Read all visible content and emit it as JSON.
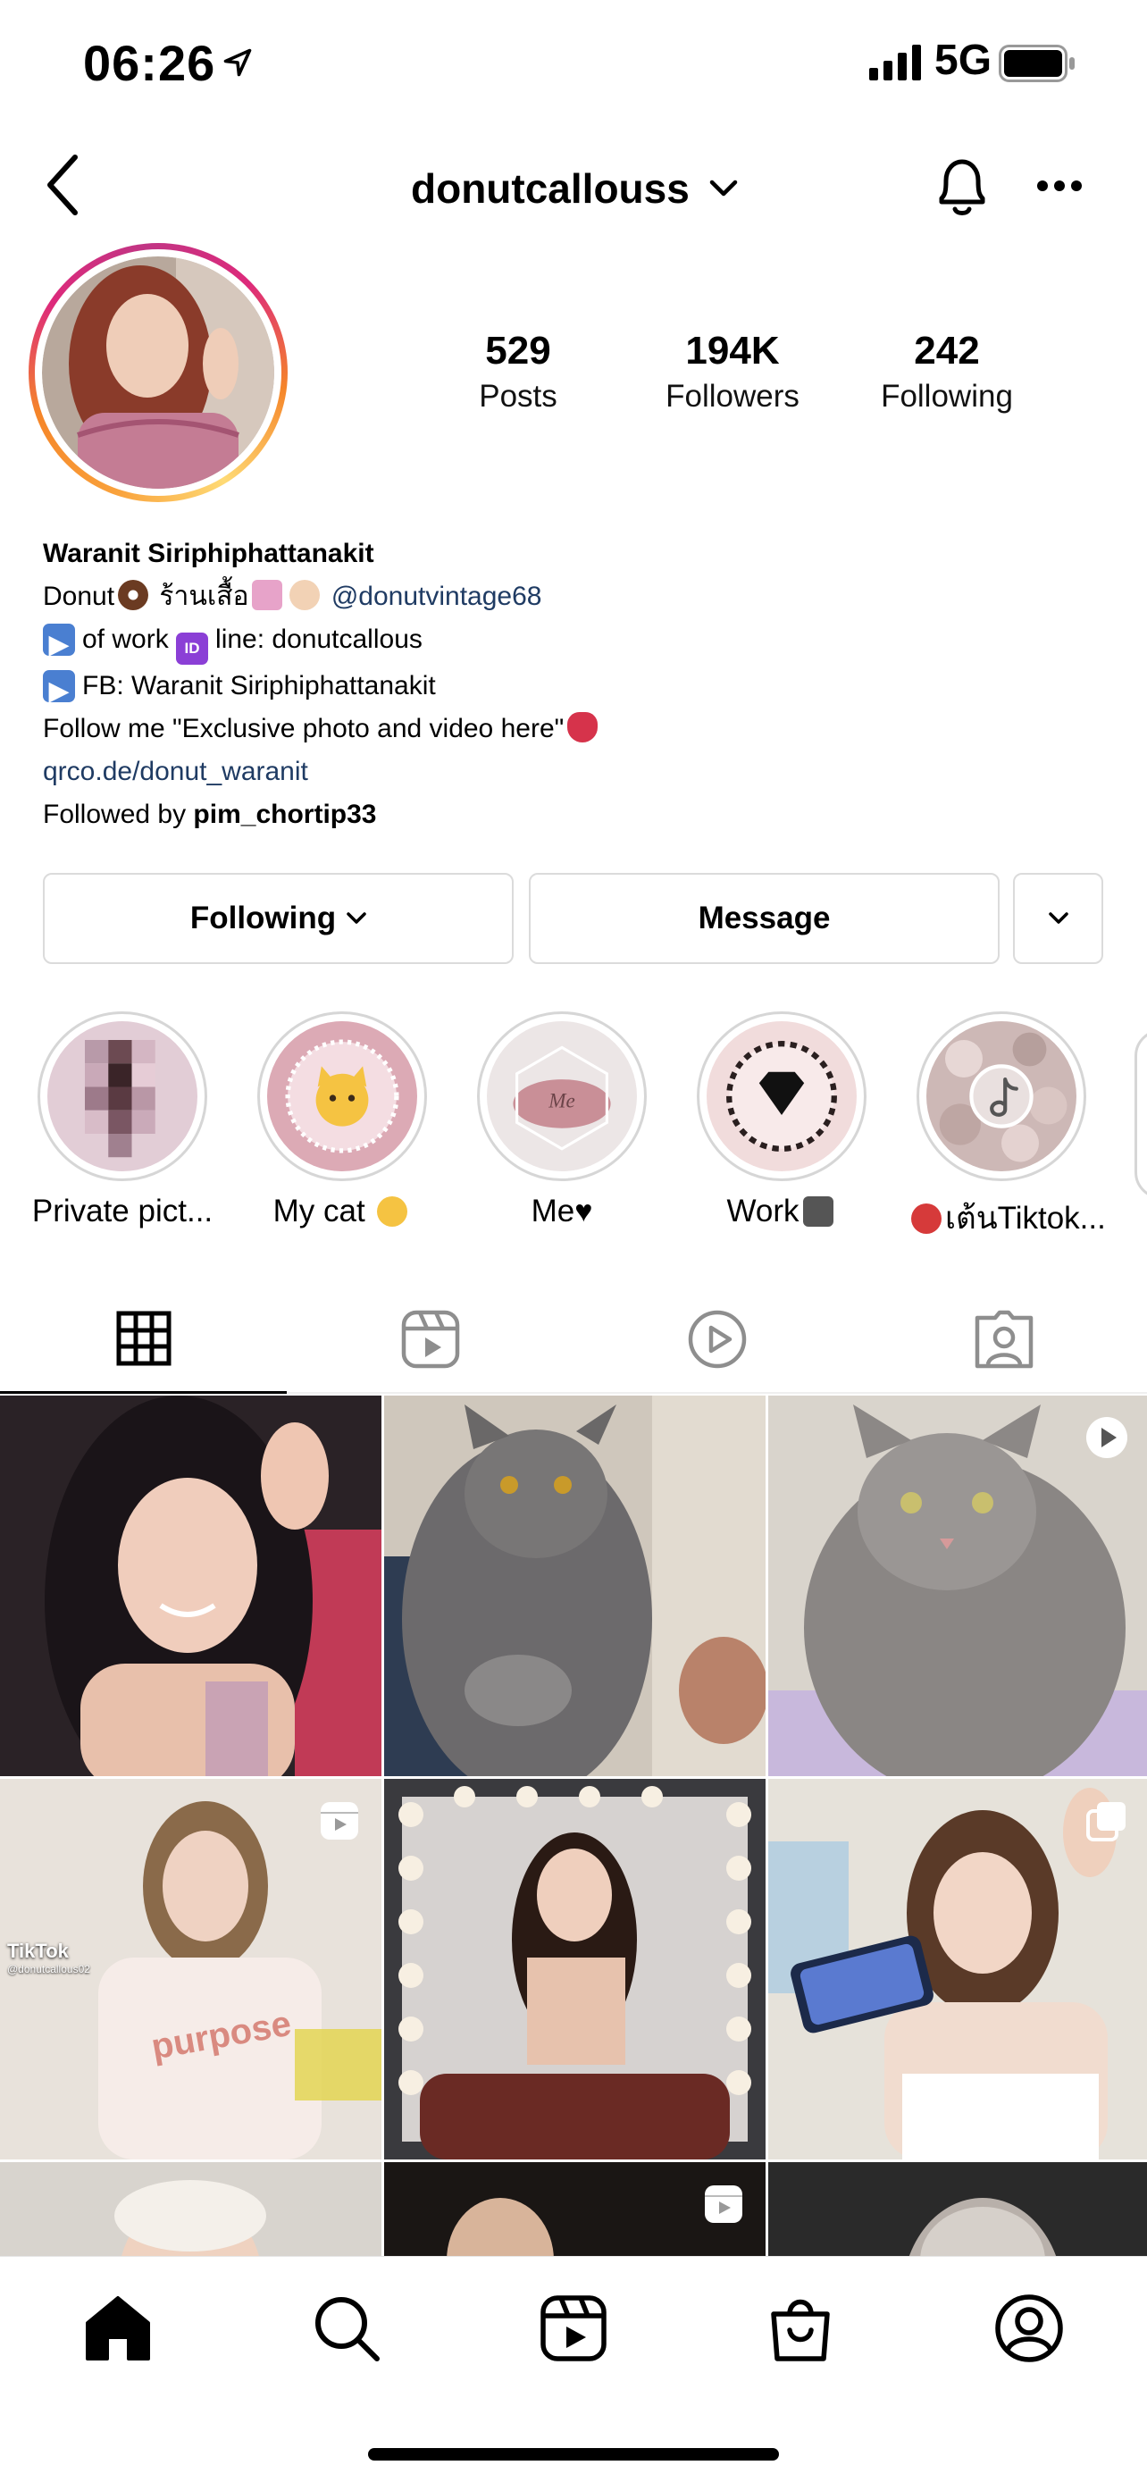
{
  "status_bar": {
    "time": "06:26",
    "network": "5G"
  },
  "header": {
    "username": "donutcallouss"
  },
  "profile": {
    "stats": [
      {
        "value": "529",
        "label": "Posts"
      },
      {
        "value": "194K",
        "label": "Followers"
      },
      {
        "value": "242",
        "label": "Following"
      }
    ],
    "name": "Waranit Siriphiphattanakit",
    "bio_line1_text": "Donut",
    "bio_line1_thai": "ร้านเสื้อ",
    "bio_line1_mention": "@donutvintage68",
    "bio_line2_a": "of work",
    "bio_line2_b": "line: donutcallous",
    "bio_line3": "FB: Waranit Siriphiphattanakit",
    "bio_line4": "Follow me \"Exclusive photo and video here\"",
    "bio_link": "qrco.de/donut_waranit",
    "followed_by_prefix": "Followed by",
    "followed_by_user": "pim_chortip33"
  },
  "actions": {
    "following_label": "Following",
    "message_label": "Message"
  },
  "highlights": [
    {
      "label": "Private pict..."
    },
    {
      "label": "My cat"
    },
    {
      "label": "Me"
    },
    {
      "label": "Work"
    },
    {
      "label": "เต้นTiktok..."
    }
  ],
  "grid_posts": [
    {
      "type": "photo",
      "subject": "selfie"
    },
    {
      "type": "photo",
      "subject": "cat"
    },
    {
      "type": "video",
      "subject": "cat"
    },
    {
      "type": "reel",
      "subject": "tiktok",
      "overlay_title": "TikTok",
      "overlay_user": "@donutcallous02"
    },
    {
      "type": "photo",
      "subject": "mirror"
    },
    {
      "type": "carousel",
      "subject": "phone"
    },
    {
      "type": "photo",
      "subject": "partial"
    },
    {
      "type": "reel",
      "subject": "partial"
    },
    {
      "type": "photo",
      "subject": "partial"
    }
  ],
  "colors": {
    "link": "#1f3b63",
    "border": "#dbdbdb"
  }
}
